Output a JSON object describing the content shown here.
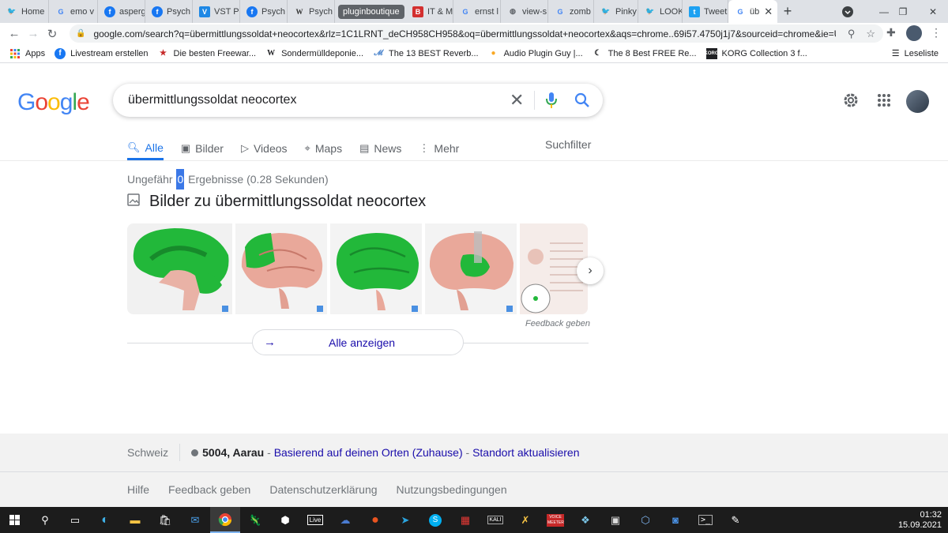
{
  "browser": {
    "tabs": [
      {
        "label": "Home",
        "icon": "twitter-icon",
        "color": "#1da1f2"
      },
      {
        "label": "emo v",
        "icon": "google-icon",
        "color": "#4285f4"
      },
      {
        "label": "asperg",
        "icon": "facebook-icon",
        "color": "#1877f2"
      },
      {
        "label": "Psych",
        "icon": "facebook-icon",
        "color": "#1877f2"
      },
      {
        "label": "VST Pl",
        "icon": "vst-icon",
        "color": "#1e88e5"
      },
      {
        "label": "Psych",
        "icon": "facebook-icon",
        "color": "#1877f2"
      },
      {
        "label": "Psych",
        "icon": "wikipedia-icon",
        "color": "#333333"
      },
      {
        "label": "pluginboutique",
        "icon": "group",
        "color": "#5f6368"
      },
      {
        "label": "IT & M",
        "icon": "b-icon",
        "color": "#d32f2f"
      },
      {
        "label": "ernst l",
        "icon": "google-icon",
        "color": "#4285f4"
      },
      {
        "label": "view-s",
        "icon": "globe-icon",
        "color": "#5f6368"
      },
      {
        "label": "zomb",
        "icon": "google-icon",
        "color": "#4285f4"
      },
      {
        "label": "Pinky",
        "icon": "twitter-icon",
        "color": "#1da1f2"
      },
      {
        "label": "LOOK",
        "icon": "twitter-icon",
        "color": "#1da1f2"
      },
      {
        "label": "Tweet",
        "icon": "twitter-icon",
        "color": "#1da1f2"
      },
      {
        "label": "üb",
        "icon": "google-icon",
        "color": "#4285f4",
        "active": true
      }
    ],
    "url": "google.com/search?q=übermittlungssoldat+neocortex&rlz=1C1LRNT_deCH958CH958&oq=übermittlungssoldat+neocortex&aqs=chrome..69i57.4750j1j7&sourceid=chrome&ie=UTF-8",
    "bookmarks": [
      {
        "label": "Apps",
        "icon": "apps-grid-icon"
      },
      {
        "label": "Livestream erstellen",
        "icon": "facebook-icon"
      },
      {
        "label": "Die besten Freewar...",
        "icon": "star-icon"
      },
      {
        "label": "Sondermülldeponie...",
        "icon": "wikipedia-icon"
      },
      {
        "label": "The 13 BEST Reverb...",
        "icon": "swirl-icon"
      },
      {
        "label": "Audio Plugin Guy |...",
        "icon": "plugin-guy-icon"
      },
      {
        "label": "The 8 Best FREE Re...",
        "icon": "moon-icon"
      },
      {
        "label": "KORG Collection 3 f...",
        "icon": "korg-icon"
      }
    ],
    "reading_list": "Leseliste"
  },
  "google": {
    "query": "übermittlungssoldat neocortex",
    "nav_tabs": [
      {
        "label": "Alle",
        "icon": "search-icon",
        "active": true
      },
      {
        "label": "Bilder",
        "icon": "image-icon"
      },
      {
        "label": "Videos",
        "icon": "play-icon"
      },
      {
        "label": "Maps",
        "icon": "map-pin-icon"
      },
      {
        "label": "News",
        "icon": "news-icon"
      },
      {
        "label": "Mehr",
        "icon": "more-vert-icon"
      }
    ],
    "suchfilter": "Suchfilter",
    "stats_prefix": "Ungefähr",
    "stats_count": "0",
    "stats_suffix": "Ergebnisse (0.28 Sekunden)",
    "images_heading": "Bilder zu übermittlungssoldat neocortex",
    "feedback": "Feedback geben",
    "show_all": "Alle anzeigen",
    "thumb_colors": {
      "green": "#22b83a",
      "skin": "#e9a89a"
    }
  },
  "footer": {
    "country": "Schweiz",
    "location": "5004, Aarau",
    "location_sep": " - ",
    "basis": "Basierend auf deinen Orten (Zuhause)",
    "update": "Standort aktualisieren",
    "links": [
      "Hilfe",
      "Feedback geben",
      "Datenschutzerklärung",
      "Nutzungsbedingungen"
    ]
  },
  "taskbar": {
    "time": "01:32",
    "date": "15.09.2021",
    "apps": [
      "windows-start-icon",
      "search-icon",
      "task-view-icon",
      "edge-icon",
      "file-explorer-icon",
      "store-icon",
      "mail-icon",
      "chrome-icon",
      "app-icon",
      "app-icon",
      "ableton-live-icon",
      "app-icon",
      "ubuntu-icon",
      "telegram-icon",
      "skype-icon",
      "app-icon",
      "kali-icon",
      "app-icon",
      "voicemeeter-icon",
      "app-icon",
      "app-icon",
      "virtualbox-icon",
      "app-icon",
      "terminal-icon",
      "notepad-icon"
    ],
    "live_label": "Live",
    "kali_label": "KALI",
    "voice_label": "VOICE MEETER"
  }
}
